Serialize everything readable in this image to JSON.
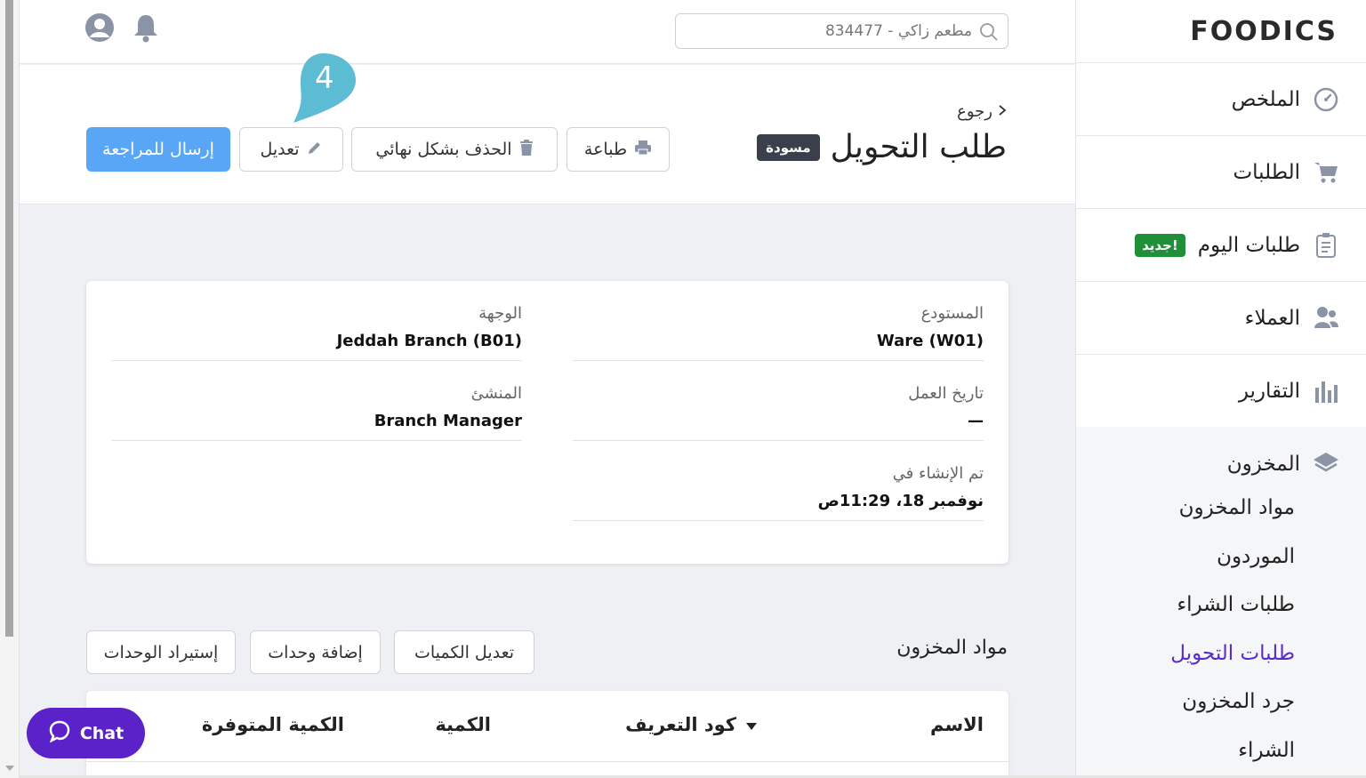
{
  "sidebar": {
    "logo": "FOODICS",
    "items": [
      {
        "label": "الملخص",
        "icon": "dashboard-icon"
      },
      {
        "label": "الطلبات",
        "icon": "cart-icon"
      },
      {
        "label": "طلبات اليوم",
        "icon": "clipboard-icon",
        "badge": "جديد!"
      },
      {
        "label": "العملاء",
        "icon": "users-icon"
      },
      {
        "label": "التقارير",
        "icon": "bar-chart-icon"
      }
    ],
    "inventory": {
      "label": "المخزون",
      "icon": "layers-icon",
      "sub_items": [
        "مواد المخزون",
        "الموردون",
        "طلبات الشراء",
        "طلبات التحويل",
        "جرد المخزون",
        "الشراء"
      ],
      "active_index": 3
    }
  },
  "topbar": {
    "search_value": "مطعم زاكي - 834477"
  },
  "header": {
    "back_label": "رجوع",
    "title": "طلب التحويل",
    "status_badge": "مسودة",
    "print_label": "طباعة",
    "delete_label": "الحذف بشكل نهائي",
    "edit_label": "تعديل",
    "submit_label": "إرسال للمراجعة",
    "step_number": "4"
  },
  "details": {
    "warehouse_label": "المستودع",
    "warehouse_value": "Ware (W01)",
    "destination_label": "الوجهة",
    "destination_value": "Jeddah Branch (B01)",
    "business_date_label": "تاريخ العمل",
    "business_date_value": "—",
    "creator_label": "المنشئ",
    "creator_value": "Branch Manager",
    "created_at_label": "تم الإنشاء في",
    "created_at_value": "نوفمبر 18، 11:29ص"
  },
  "items_section": {
    "title": "مواد المخزون",
    "edit_quantities": "تعديل الكميات",
    "add_items": "إضافة وحدات",
    "import_items": "إستيراد الوحدات",
    "columns": [
      "الاسم",
      "كود التعريف",
      "الكمية",
      "الكمية المتوفرة"
    ]
  },
  "chat": {
    "label": "Chat"
  },
  "colors": {
    "accent": "#58a6f5",
    "active": "#5b2bc8",
    "chat": "#5a22c8",
    "badge_new": "#1f8f3a"
  }
}
